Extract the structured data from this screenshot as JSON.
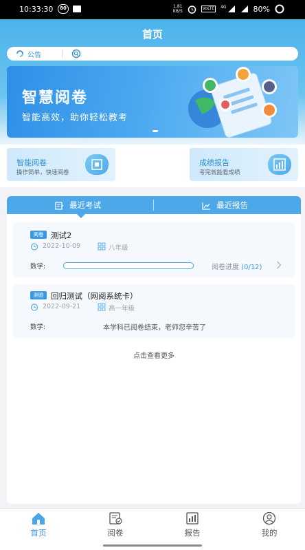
{
  "status_bar": {
    "time": "10:33:30",
    "badge": "80",
    "net_speed_value": "1.81",
    "net_speed_unit": "KB/S",
    "volte": "VoLTE",
    "signal_label": "4G",
    "battery": "80%"
  },
  "header": {
    "title": "首页"
  },
  "search": {
    "notice_label": "公告"
  },
  "banner": {
    "title": "智慧阅卷",
    "subtitle": "智能高效，助你轻松教考"
  },
  "quick": [
    {
      "title": "智能阅卷",
      "subtitle": "操作简单，快速阅卷"
    },
    {
      "title": "成绩报告",
      "subtitle": "考完就能看成绩"
    }
  ],
  "tabs": [
    {
      "label": "最近考试"
    },
    {
      "label": "最近报告"
    }
  ],
  "exams": [
    {
      "tag": "阅卷",
      "title": "测试2",
      "date": "2022-10-09",
      "grade": "八年级",
      "subject": "数学:",
      "progress_label": "阅卷进度",
      "progress_value": "(0/12)",
      "progress_fraction": 0
    },
    {
      "tag": "测验",
      "title": "回归测试（网阅系统卡）",
      "date": "2022-09-21",
      "grade": "高一年级",
      "subject": "数学:",
      "status_text": "本学科已阅卷结束，老师您辛苦了"
    }
  ],
  "more_link": "点击查看更多",
  "nav": [
    {
      "label": "首页",
      "icon": "home-icon",
      "active": true
    },
    {
      "label": "阅卷",
      "icon": "paper-review-icon",
      "active": false
    },
    {
      "label": "报告",
      "icon": "report-icon",
      "active": false
    },
    {
      "label": "我的",
      "icon": "profile-icon",
      "active": false
    }
  ],
  "colors": {
    "accent": "#44a7ea",
    "header": "#4bb3ea",
    "tag": "#3a9be4"
  }
}
